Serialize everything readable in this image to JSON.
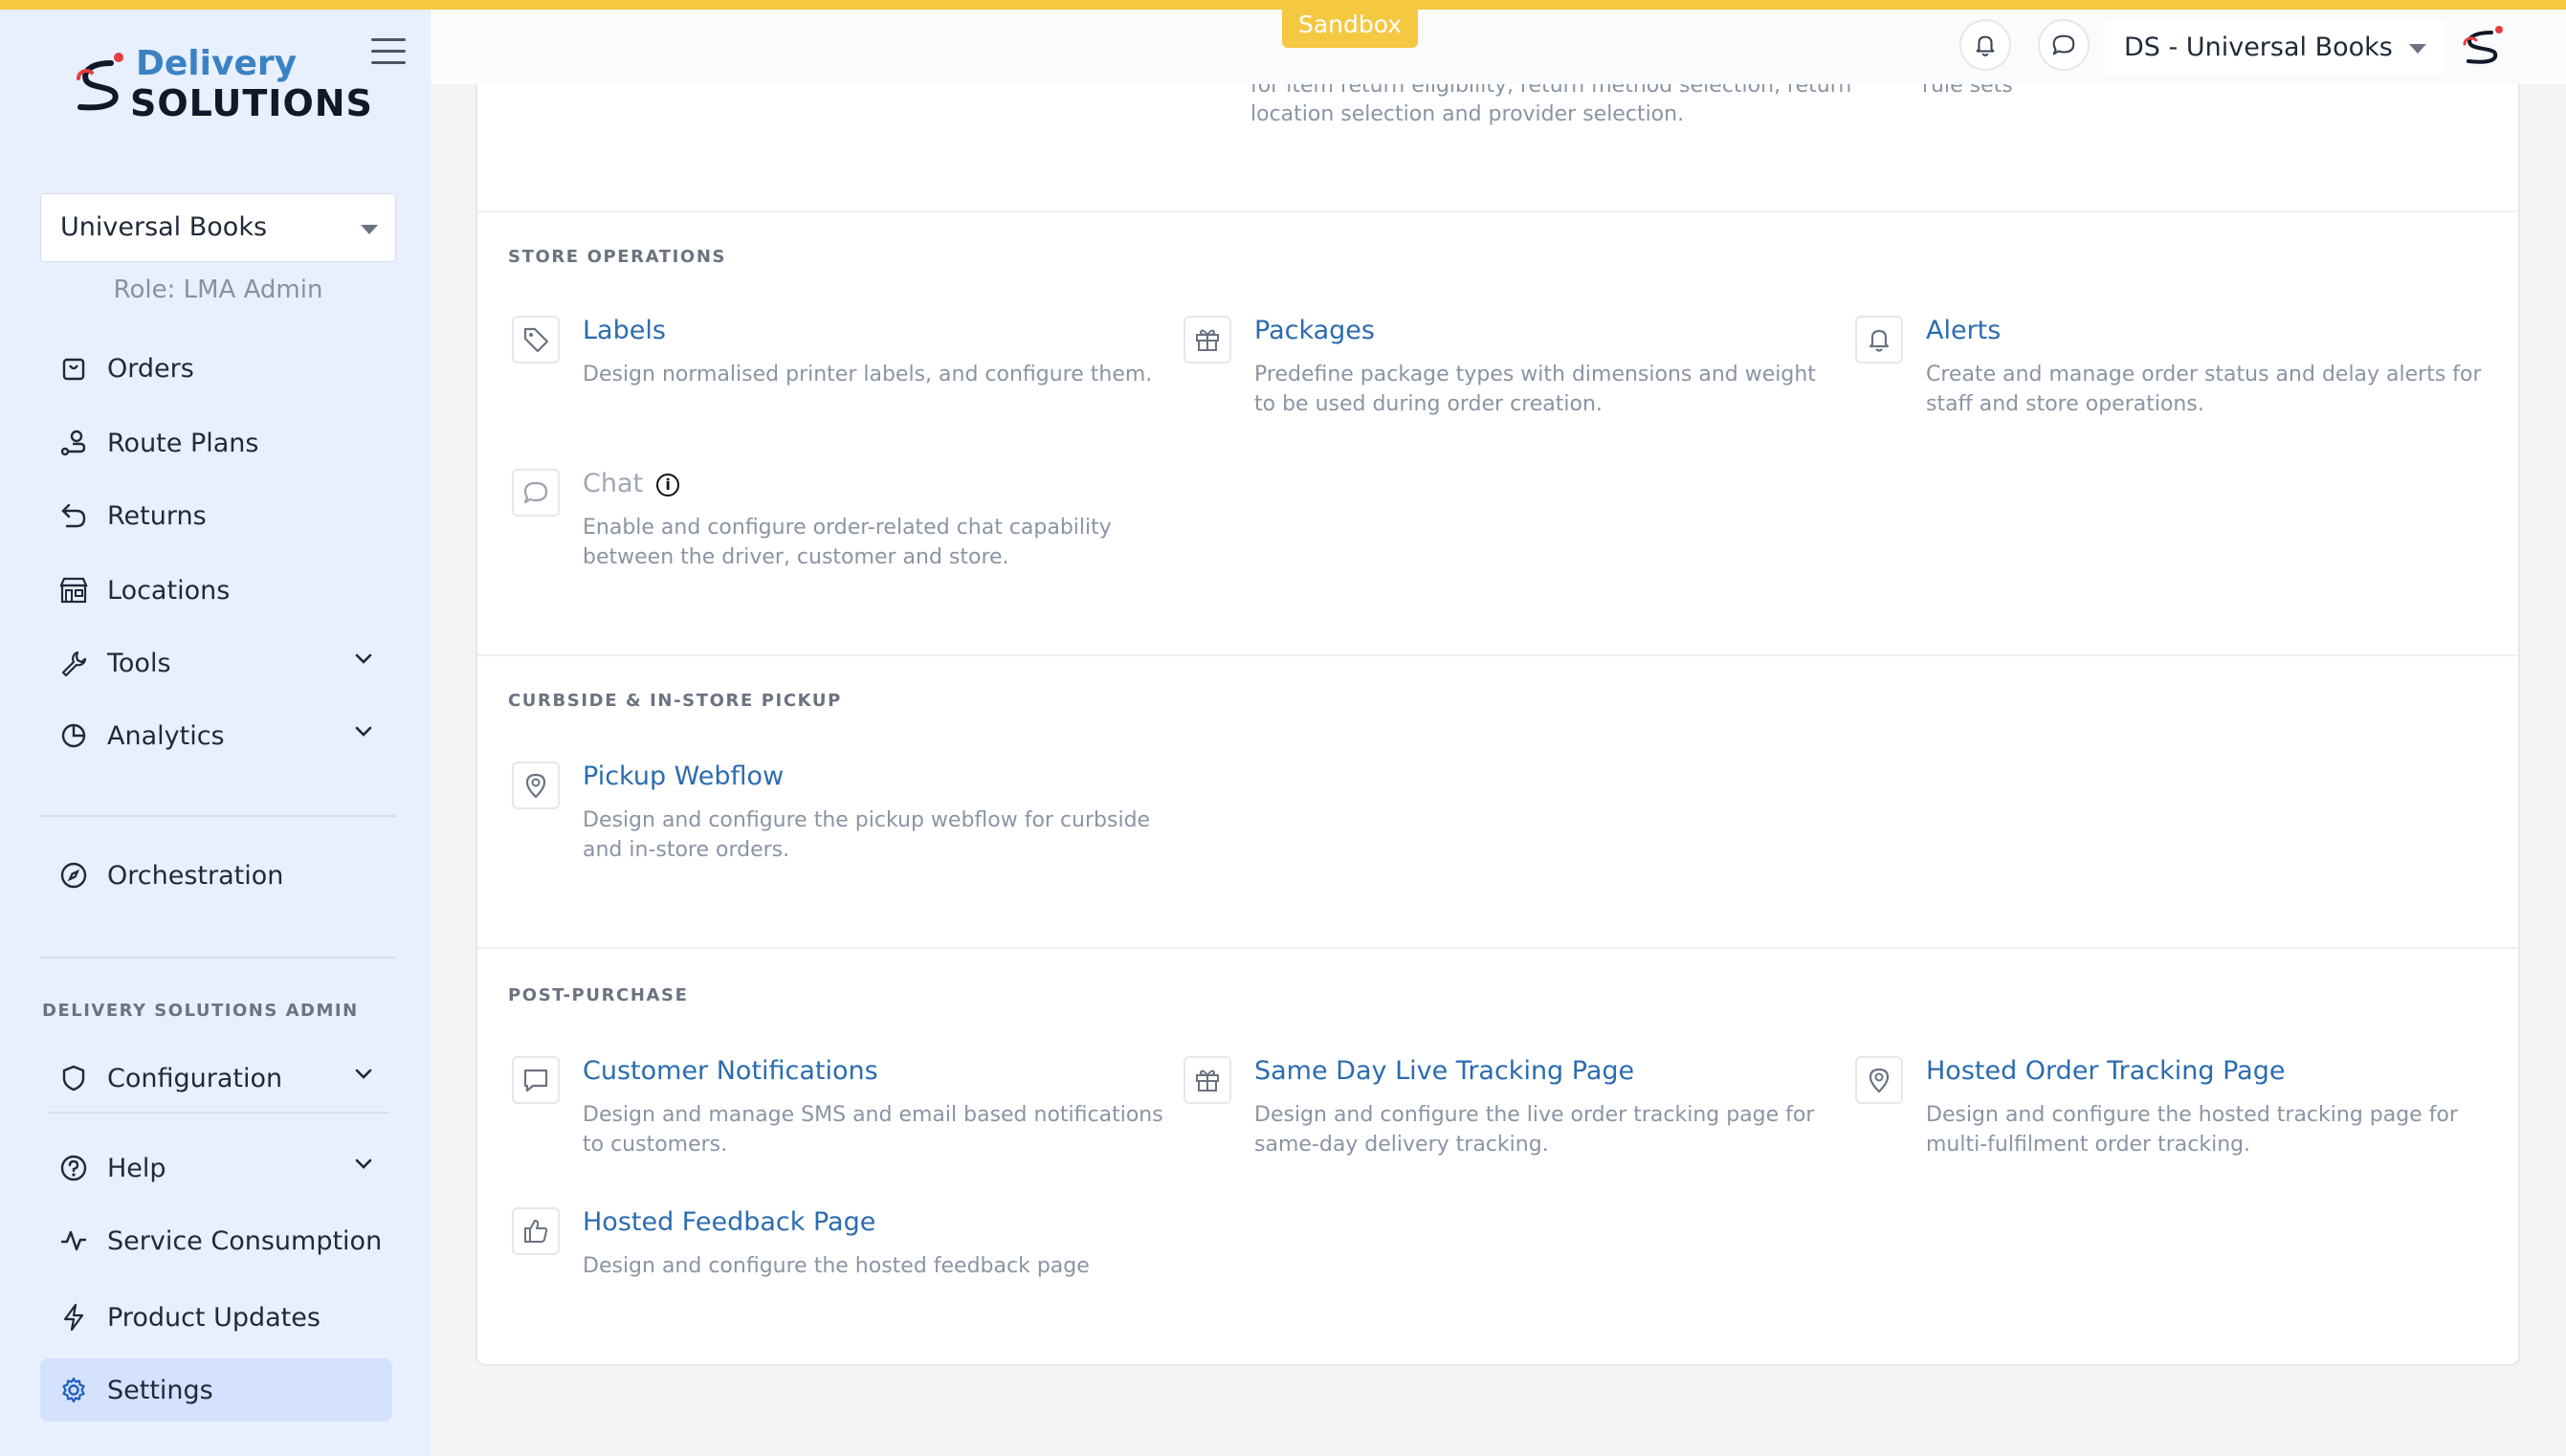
{
  "badge": {
    "sandbox": "Sandbox"
  },
  "brand": {
    "word1": "Delivery",
    "word2": "SOLUTIONS"
  },
  "sidebar": {
    "org": "Universal Books",
    "role": "Role: LMA Admin",
    "items": [
      {
        "label": "Orders"
      },
      {
        "label": "Route Plans"
      },
      {
        "label": "Returns"
      },
      {
        "label": "Locations"
      },
      {
        "label": "Tools"
      },
      {
        "label": "Analytics"
      },
      {
        "label": "Orchestration"
      },
      {
        "label": "Configuration"
      },
      {
        "label": "Help"
      },
      {
        "label": "Service Consumption"
      },
      {
        "label": "Product Updates"
      },
      {
        "label": "Settings"
      }
    ],
    "admin_label": "DELIVERY SOLUTIONS ADMIN"
  },
  "header": {
    "account": "DS - Universal Books"
  },
  "top_cut": {
    "left_line1": "for item return eligibility, return method selection, return",
    "left_line2": "location selection and provider selection.",
    "right_line1": "rule sets"
  },
  "sections": {
    "store_ops": {
      "title": "STORE OPERATIONS",
      "cards": [
        {
          "title": "Labels",
          "desc": "Design normalised printer labels, and configure them."
        },
        {
          "title": "Packages",
          "desc": "Predefine package types with dimensions and weight to be used during order creation."
        },
        {
          "title": "Alerts",
          "desc": "Create and manage order status and delay alerts for staff and store operations."
        },
        {
          "title": "Chat",
          "desc": "Enable and configure order-related chat capability between the driver, customer and store."
        }
      ]
    },
    "pickup": {
      "title": "CURBSIDE & IN-STORE PICKUP",
      "cards": [
        {
          "title": "Pickup Webflow",
          "desc": "Design and configure the pickup webflow for curbside and in-store orders."
        }
      ]
    },
    "post": {
      "title": "POST-PURCHASE",
      "cards": [
        {
          "title": "Customer Notifications",
          "desc": "Design and manage SMS and email based notifications to customers."
        },
        {
          "title": "Same Day Live Tracking Page",
          "desc": "Design and configure the live order tracking page for same-day delivery tracking."
        },
        {
          "title": "Hosted Order Tracking Page",
          "desc": "Design and configure the hosted tracking page for multi-fulfilment order tracking."
        },
        {
          "title": "Hosted Feedback Page",
          "desc": "Design and configure the hosted feedback page"
        }
      ]
    }
  },
  "colors": {
    "accent": "#f5c842",
    "link": "#2b6cb0",
    "sidebar_bg": "#e8efff",
    "active_bg": "#d4e2ff"
  }
}
